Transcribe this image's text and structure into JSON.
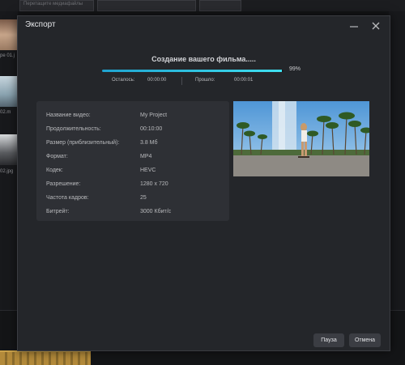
{
  "background": {
    "top_chip_text": "Перетащите медиафайлы",
    "thumbnails": [
      {
        "label": "ре 01.j"
      },
      {
        "label": "02.m"
      },
      {
        "label": "02.jpg"
      }
    ]
  },
  "dialog": {
    "title": "Экспорт",
    "heading": "Создание вашего фильма.....",
    "progress": 0.99,
    "percent_text": "99%",
    "remaining_label": "Осталось:",
    "remaining_value": "00:00:00",
    "elapsed_label": "Прошло:",
    "elapsed_value": "00:00:01",
    "info": [
      {
        "label": "Название видео:",
        "value": "My Project"
      },
      {
        "label": "Продолжительность:",
        "value": "00:10:00"
      },
      {
        "label": "Размер (приблизительный):",
        "value": "3.8 Мб"
      },
      {
        "label": "Формат:",
        "value": "MP4"
      },
      {
        "label": "Кодек:",
        "value": "HEVC"
      },
      {
        "label": "Разрешение:",
        "value": "1280 x 720"
      },
      {
        "label": "Частота кадров:",
        "value": "25"
      },
      {
        "label": "Битрейт:",
        "value": "3000 Кбит/с"
      }
    ],
    "pause_label": "Пауза",
    "cancel_label": "Отмена"
  },
  "colors": {
    "dialog_bg": "#24262a",
    "panel_bg": "#2e3035",
    "accent": "#2fc4e6"
  },
  "icons": {
    "minimize": "minimize-icon",
    "close": "close-icon"
  }
}
